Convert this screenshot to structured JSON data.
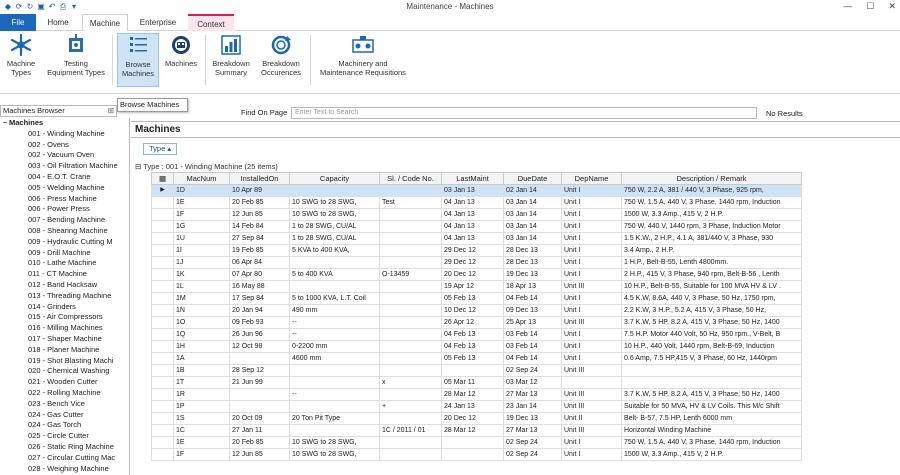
{
  "window": {
    "title": "Maintenance - Machines"
  },
  "ribbon_tabs": [
    {
      "label": "File"
    },
    {
      "label": "Home"
    },
    {
      "label": "Machine"
    },
    {
      "label": "Enterprise"
    },
    {
      "label": "Context"
    }
  ],
  "ribbon_buttons": [
    {
      "label": "Machine\nTypes",
      "icon": "snowflake-icon"
    },
    {
      "label": "Testing\nEquipment Types",
      "icon": "equipment-icon"
    },
    {
      "label": "Browse\nMachines",
      "icon": "list-icon"
    },
    {
      "label": "Machines",
      "icon": "machine-icon"
    },
    {
      "label": "Breakdown\nSummary",
      "icon": "chart-icon"
    },
    {
      "label": "Breakdown\nOccurences",
      "icon": "refresh-icon"
    },
    {
      "label": "Machinery and\nMaintenance Requisitions",
      "icon": "requisition-icon"
    }
  ],
  "tooltip": "Browse Machines",
  "left_panel": {
    "title": "Machines Browser",
    "root": "Machines",
    "items": [
      "001 - Winding Machine",
      "002 - Ovens",
      "002 - Vacuum Oven",
      "003 - Oil Filtration Machine",
      "004 - E.O.T. Crane",
      "005 - Welding Machine",
      "006 - Press Machine",
      "006 - Power Press",
      "007 - Bending Machine",
      "008 - Shearing Machine",
      "009 - Hydraulic Cutting M",
      "009 - Drill Machine",
      "010 - Lathe Machine",
      "011 - CT Machine",
      "012 - Band Hacksaw",
      "013 - Threading Machine",
      "014 - Grinders",
      "015 - Air Compressors",
      "016 - Milling Machines",
      "017 - Shaper Machine",
      "018 - Planer Machine",
      "019 - Shot Blasting Machi",
      "020 - Chemical Washing",
      "021 - Wooden Cutter",
      "022 - Rolling Machine",
      "023 - Bench Vice",
      "024 - Gas Cutter",
      "024 - Gas Torch",
      "025 - Circle Cutter",
      "026 - Static Ring Machine",
      "027 - Circular Cutting Mac",
      "028 - Weighing Machine"
    ]
  },
  "find": {
    "label": "Find On Page",
    "placeholder": "Enter Text to Search",
    "result": "No Results"
  },
  "main": {
    "title": "Machines",
    "group_button": "Type",
    "group_header": "Type : 001 - Winding Machine (25 items)",
    "columns": [
      "MacNum",
      "InstalledOn",
      "Capacity",
      "Sl. / Code No.",
      "LastMaint",
      "DueDate",
      "DepName",
      "Description / Remark"
    ],
    "rows": [
      [
        "1D",
        "10 Apr 89",
        "",
        "",
        "03 Jan 13",
        "02 Jan 14",
        "Unit I",
        "750 W, 2.2 A, 381 / 440 V, 3 Phase, 925 rpm,"
      ],
      [
        "1E",
        "20 Feb 85",
        "10 SWG to 28 SWG,",
        "Test",
        "04 Jan 13",
        "03 Jan 14",
        "Unit I",
        "750 W, 1.5 A, 440 V, 3 Phase, 1440 rpm, Induction"
      ],
      [
        "1F",
        "12 Jun 85",
        "10 SWG to 28 SWG,",
        "",
        "04 Jan 13",
        "03 Jan 14",
        "Unit I",
        "1500 W, 3.3 Amp., 415 V, 2 H.P."
      ],
      [
        "1G",
        "14 Feb 84",
        "1 to 28 SWG, CU/AL",
        "",
        "04 Jan 13",
        "03 Jan 14",
        "Unit I",
        "750 W, 440 V, 1440 rpm, 3 Phase, Induction Motor"
      ],
      [
        "1U",
        "27 Sep 84",
        "1 to 28 SWG, CU/AL",
        "",
        "04 Jan 13",
        "03 Jan 14",
        "Unit I",
        "1.5 K.W., 2 H.P., 4.1 A, 381/440 V, 3 Phase, 930"
      ],
      [
        "1I",
        "19 Feb 85",
        "5 KVA to 400 KVA,",
        "",
        "29 Dec 12",
        "28 Dec 13",
        "Unit I",
        "3.4 Amp., 2 H.P."
      ],
      [
        "1J",
        "06 Apr 84",
        "",
        "",
        "29 Dec 12",
        "28 Dec 13",
        "Unit I",
        "1 H.P., Belt-B-55, Lenth 4800mm."
      ],
      [
        "1K",
        "07 Apr 80",
        "5 to 400 KVA",
        "O-13459",
        "20 Dec 12",
        "19 Dec 13",
        "Unit I",
        "2 H.P., 415 V, 3 Phase, 940 rpm, Belt-B-56 , Lenth"
      ],
      [
        "1L",
        "16 May 88",
        "",
        "",
        "19 Apr 12",
        "18 Apr 13",
        "Unit III",
        "10 H.P., Belt-B-55, Suitable for 100 MVA HV & LV ."
      ],
      [
        "1M",
        "17 Sep 84",
        "5 to 1000 KVA, L.T. Coil",
        "",
        "05 Feb 13",
        "04 Feb 14",
        "Unit I",
        "4.5 K.W, 8.6A, 440 V, 3 Phase, 50 Hz, 1750 rpm,"
      ],
      [
        "1N",
        "20 Jan 94",
        "490 mm",
        "",
        "10 Dec 12",
        "09 Dec 13",
        "Unit I",
        "2.2 K.W, 3 H.P., 5.2 A, 415 V, 3 Phase, 50 Hz,"
      ],
      [
        "1O",
        "09 Feb 93",
        "--",
        "",
        "26 Apr 12",
        "25 Apr 13",
        "Unit III",
        "3.7 K.W, 5 HP, 8.2 A, 415 V, 3 Phase, 50 Hz, 1400"
      ],
      [
        "1Q",
        "26 Jun 96",
        "--",
        "",
        "04 Feb 13",
        "03 Feb 14",
        "Unit I",
        "7.5 H.P. Motor 440 Volt, 50 Hz, 950 rpm., V-Belt, B"
      ],
      [
        "1H",
        "12 Oct 98",
        "0-2200 mm",
        "",
        "04 Feb 13",
        "03 Feb 14",
        "Unit I",
        "10 H.P., 440 Volt, 1440 rpm, Belt-B-69, Induction"
      ],
      [
        "1A",
        "",
        "4600 mm",
        "",
        "05 Feb 13",
        "04 Feb 14",
        "Unit I",
        "0.6 Amp, 7.5 HP,415 V, 3 Phase, 60 Hz, 1440rpm"
      ],
      [
        "1B",
        "28 Sep 12",
        "",
        "",
        "",
        "02 Sep 24",
        "Unit III",
        ""
      ],
      [
        "1T",
        "21 Jun 99",
        "",
        "x",
        "05 Mar 11",
        "03 Mar 12",
        "",
        ""
      ],
      [
        "1R",
        "",
        "--",
        "",
        "28 Mar 12",
        "27 Mar 13",
        "Unit III",
        "3.7 K.W, 5 HP, 8.2 A, 415 V, 3 Phase, 50 Hz, 1400"
      ],
      [
        "1P",
        "",
        "",
        "+",
        "24 Jan 13",
        "23 Jan 14",
        "Unit III",
        "Suitable for 50 MVA, HV & LV Coils. This M/c Shift"
      ],
      [
        "1S",
        "20 Oct 09",
        "20 Ton Pit Type",
        "",
        "20 Dec 12",
        "19 Dec 13",
        "Unit II",
        "Belt- B-57, 7.5 HP, Lenth 6000 mm"
      ],
      [
        "1C",
        "27 Jan 11",
        "",
        "1C / 2011 / 01",
        "28 Mar 12",
        "27 Mar 13",
        "Unit III",
        "Horizontal Winding Machine"
      ],
      [
        "1E",
        "20 Feb 85",
        "10 SWG to 28 SWG,",
        "",
        "",
        "02 Sep 24",
        "Unit I",
        "750 W, 1.5 A, 440 V, 3 Phase, 1440 rpm, Induction"
      ],
      [
        "1F",
        "12 Jun 85",
        "10 SWG to 28 SWG,",
        "",
        "",
        "02 Sep 24",
        "Unit I",
        "1500 W, 3.3 Amp., 415 V, 2 H.P."
      ]
    ]
  }
}
